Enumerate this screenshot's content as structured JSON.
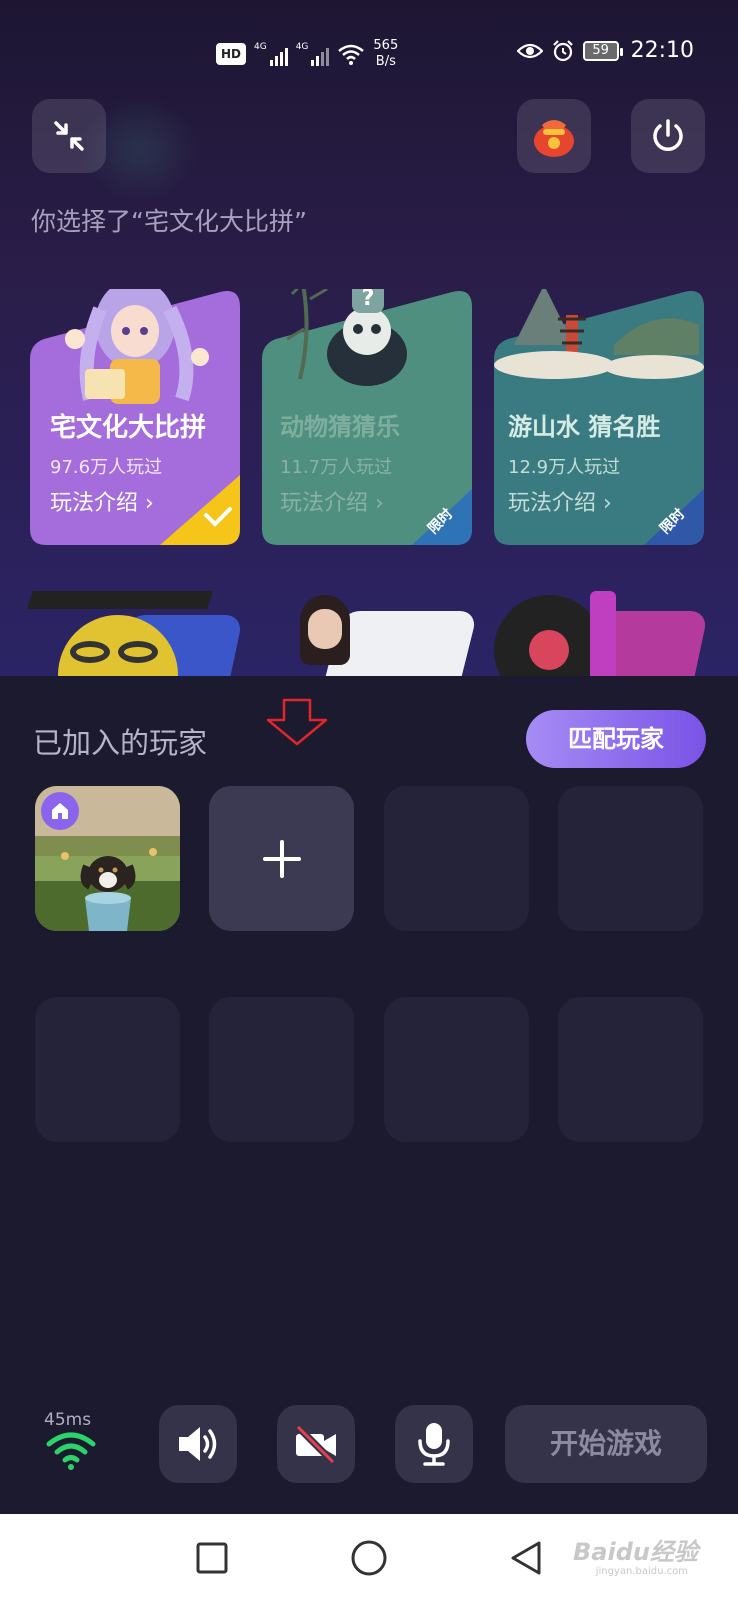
{
  "status_bar": {
    "hd_badge": "HD",
    "net_tag_1": "4G",
    "net_tag_2": "4G",
    "speed_value": "565",
    "speed_unit": "B/s",
    "battery": "59",
    "time": "22:10"
  },
  "header": {
    "selected_text": "你选择了“宅文化大比拼”"
  },
  "games": [
    {
      "title": "宅文化大比拼",
      "players": "97.6万人玩过",
      "link": "玩法介绍 ›",
      "selected": true,
      "color": "#a36bdc"
    },
    {
      "title": "动物猜猜乐",
      "players": "11.7万人玩过",
      "link": "玩法介绍 ›",
      "badge": "限时",
      "color": "#4c8f7e"
    },
    {
      "title": "游山水 猜名胜",
      "players": "12.9万人玩过",
      "link": "玩法介绍 ›",
      "badge": "限时",
      "color": "#3a7e84"
    }
  ],
  "players_section": {
    "title": "已加入的玩家",
    "match_button": "匹配玩家"
  },
  "controls": {
    "latency": "45ms",
    "start_button": "开始游戏"
  },
  "watermark": {
    "text": "Baidu经验",
    "sub": "jingyan.baidu.com"
  },
  "colors": {
    "accent": "#8a64ec",
    "latency_green": "#2bd46a",
    "annotation_red": "#e0262b"
  }
}
